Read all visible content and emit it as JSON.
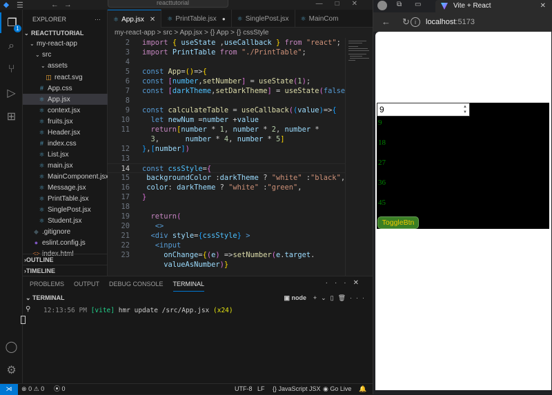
{
  "vscode": {
    "search_text": "reacttutorial",
    "explorer": {
      "title": "EXPLORER",
      "root": "REACTTUTORIAL",
      "items": [
        {
          "label": "my-react-app",
          "kind": "folder"
        },
        {
          "label": "src",
          "kind": "folder"
        },
        {
          "label": "assets",
          "kind": "folder"
        },
        {
          "label": "react.svg",
          "kind": "svg"
        },
        {
          "label": "App.css",
          "kind": "css"
        },
        {
          "label": "App.jsx",
          "kind": "jsx"
        },
        {
          "label": "context.jsx",
          "kind": "jsx"
        },
        {
          "label": "fruits.jsx",
          "kind": "jsx"
        },
        {
          "label": "Header.jsx",
          "kind": "jsx"
        },
        {
          "label": "index.css",
          "kind": "css"
        },
        {
          "label": "List.jsx",
          "kind": "jsx"
        },
        {
          "label": "main.jsx",
          "kind": "jsx"
        },
        {
          "label": "MainComponent.jsx",
          "kind": "jsx"
        },
        {
          "label": "Message.jsx",
          "kind": "jsx"
        },
        {
          "label": "PrintTable.jsx",
          "kind": "jsx"
        },
        {
          "label": "SinglePost.jsx",
          "kind": "jsx"
        },
        {
          "label": "Student.jsx",
          "kind": "jsx"
        },
        {
          "label": ".gitignore",
          "kind": "git"
        },
        {
          "label": "eslint.config.js",
          "kind": "js"
        },
        {
          "label": "index.html",
          "kind": "html"
        }
      ],
      "outline": "OUTLINE",
      "timeline": "TIMELINE"
    },
    "activity_badge": "1",
    "tabs": [
      "App.jsx",
      "PrintTable.jsx",
      "SinglePost.jsx",
      "MainCom"
    ],
    "breadcrumb": "my-react-app > src > App.jsx > {} App > {} cssStyle",
    "code_lines": [
      "2",
      "3",
      "4",
      "5",
      "6",
      "7",
      "8",
      "9",
      "10",
      "11",
      "",
      "12",
      "13",
      "14",
      "15",
      "16",
      "17",
      "18",
      "19",
      "20",
      "21",
      "22",
      "23"
    ],
    "panel": {
      "tabs": [
        "PROBLEMS",
        "OUTPUT",
        "DEBUG CONSOLE",
        "TERMINAL"
      ],
      "terminal_title": "TERMINAL",
      "terminal_shell": "node",
      "term_time": "12:13:56 PM",
      "term_vite": "[vite]",
      "term_msg": "hmr update /src/App.jsx",
      "term_count": "(x24)"
    },
    "status": {
      "problems": "0",
      "warnings": "0",
      "ports": "0",
      "encoding": "UTF-8",
      "eol": "LF",
      "language": "JavaScript JSX",
      "golive": "Go Live"
    }
  },
  "browser": {
    "tab_title": "Vite + React",
    "url_host": "localhost",
    "url_port": ":5173",
    "input_value": "9",
    "table_values": [
      "9",
      "18",
      "27",
      "36",
      "45"
    ],
    "toggle_label": "ToggleBtn"
  },
  "colors": {
    "accent": "#0078d4",
    "app_background": "#000000",
    "app_text": "green"
  }
}
